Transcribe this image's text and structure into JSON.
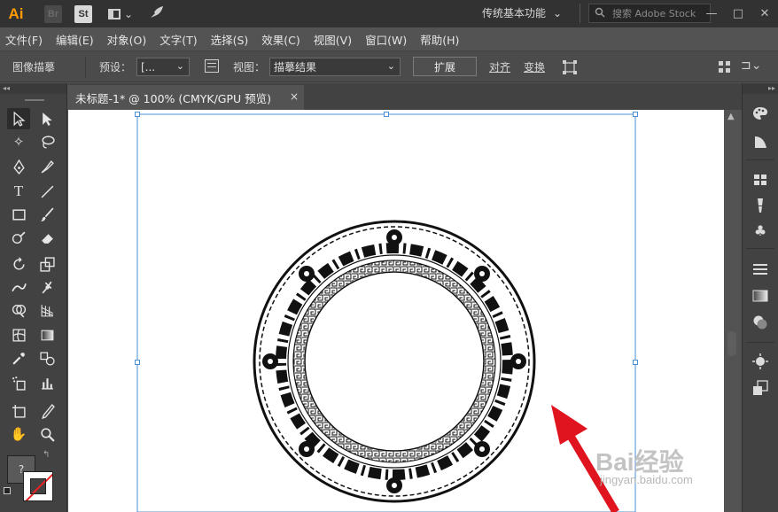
{
  "app": {
    "logo": "Ai",
    "bridge_label": "Br",
    "stock_label": "St",
    "workspace": "传统基本功能",
    "search_placeholder": "搜索 Adobe Stock",
    "window_controls": [
      "—",
      "□",
      "✕"
    ]
  },
  "menu": [
    "文件(F)",
    "编辑(E)",
    "对象(O)",
    "文字(T)",
    "选择(S)",
    "效果(C)",
    "视图(V)",
    "窗口(W)",
    "帮助(H)"
  ],
  "control_bar": {
    "panel_label": "图像描摹",
    "preset_label": "预设：",
    "preset_value": "[...",
    "view_label": "视图：",
    "view_value": "描摹结果",
    "expand_button": "扩展",
    "align_label": "对齐",
    "transform_label": "变换"
  },
  "document": {
    "tab_title": "未标题-1* @ 100% (CMYK/GPU 预览)",
    "close_label": "×"
  },
  "tools": {
    "help_glyph": "?"
  },
  "watermark": {
    "brand": "Bai经验",
    "url": "jingyan.baidu.com"
  },
  "colors": {
    "accent_logo": "#ff9a00",
    "arrow": "#e0141e",
    "selection": "#4a90d9"
  }
}
